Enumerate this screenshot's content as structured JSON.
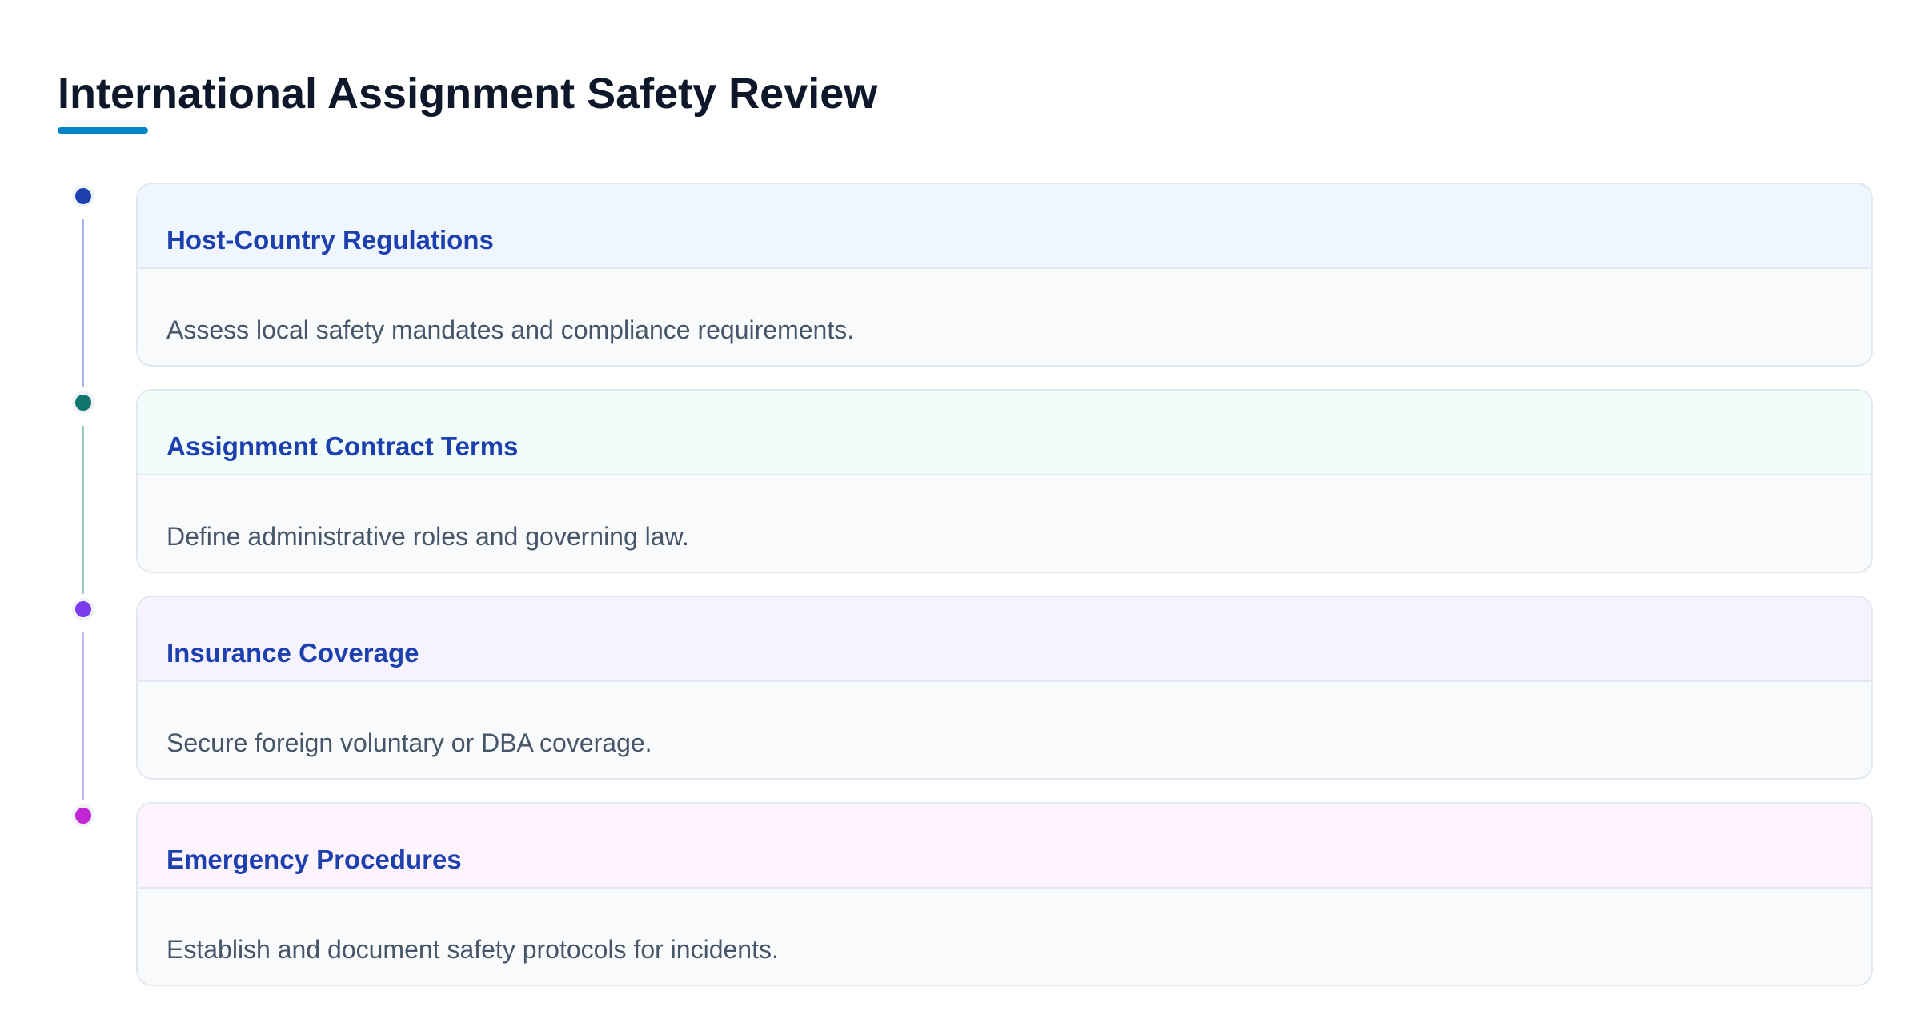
{
  "title": "International Assignment Safety Review",
  "colors": {
    "title_text": "#0f172a",
    "accent_underline": "#0284c7",
    "step_title_text": "#1e40af",
    "step_desc_text": "#475569"
  },
  "steps": [
    {
      "title": "Host-Country Regulations",
      "description": "Assess local safety mandates and compliance requirements.",
      "dot_color": "#1e40af",
      "line_color": "#a5b4fc",
      "header_bg": "#eff6ff"
    },
    {
      "title": "Assignment Contract Terms",
      "description": "Define administrative roles and governing law.",
      "dot_color": "#0f766e",
      "line_color": "#99c7c0",
      "header_bg": "#f0fdfa"
    },
    {
      "title": "Insurance Coverage",
      "description": "Secure foreign voluntary or DBA coverage.",
      "dot_color": "#7c3aed",
      "line_color": "#c4b5fd",
      "header_bg": "#f5f3ff"
    },
    {
      "title": "Emergency Procedures",
      "description": "Establish and document safety protocols for incidents.",
      "dot_color": "#c026d3",
      "line_color": "#f0abfc",
      "header_bg": "#fdf4ff"
    }
  ]
}
